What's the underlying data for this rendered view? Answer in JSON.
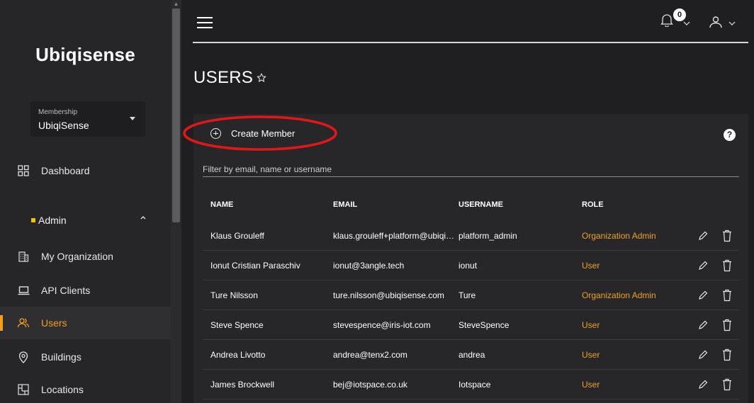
{
  "app": {
    "logo": "Ubiqisense"
  },
  "sidebar": {
    "membership": {
      "caption": "Membership",
      "value": "UbiqiSense"
    },
    "dashboard": "Dashboard",
    "admin_section": "Admin",
    "items": [
      {
        "label": "My Organization",
        "icon": "building-icon"
      },
      {
        "label": "API Clients",
        "icon": "laptop-icon"
      },
      {
        "label": "Users",
        "icon": "users-icon",
        "active": true
      },
      {
        "label": "Buildings",
        "icon": "location-pin-icon"
      },
      {
        "label": "Locations",
        "icon": "floorplan-icon"
      }
    ]
  },
  "header": {
    "notifications_count": "0"
  },
  "page": {
    "title": "USERS",
    "create_button": "Create Member",
    "help": "?",
    "filter_placeholder": "Filter by email, name or username"
  },
  "table": {
    "headers": {
      "name": "NAME",
      "email": "EMAIL",
      "username": "USERNAME",
      "role": "ROLE"
    },
    "rows": [
      {
        "name": "Klaus Grouleff",
        "email": "klaus.grouleff+platform@ubiqisense.com",
        "username": "platform_admin",
        "role": "Organization Admin"
      },
      {
        "name": "Ionut Cristian Paraschiv",
        "email": "ionut@3angle.tech",
        "username": "ionut",
        "role": "User"
      },
      {
        "name": "Ture Nilsson",
        "email": "ture.nilsson@ubiqisense.com",
        "username": "Ture",
        "role": "Organization Admin"
      },
      {
        "name": "Steve Spence",
        "email": "stevespence@iris-iot.com",
        "username": "SteveSpence",
        "role": "User"
      },
      {
        "name": "Andrea Livotto",
        "email": "andrea@tenx2.com",
        "username": "andrea",
        "role": "User"
      },
      {
        "name": "James Brockwell",
        "email": "bej@iotspace.co.uk",
        "username": "Iotspace",
        "role": "User"
      }
    ]
  },
  "colors": {
    "accent": "#f2a01b",
    "background": "#1f1f21",
    "sidebar": "#262628",
    "annotation": "#e01818"
  }
}
